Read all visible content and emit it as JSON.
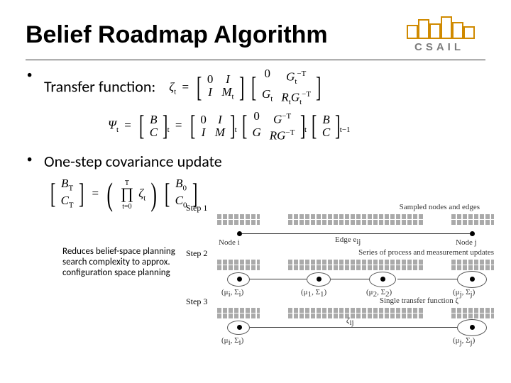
{
  "title": "Belief Roadmap Algorithm",
  "logo_word": "CSAIL",
  "bullets": {
    "b1": "Transfer function:",
    "b2": "One-step covariance update"
  },
  "eq1": {
    "lhs": "ζ",
    "lhs_sub": "t",
    "eqs": "=",
    "m1": {
      "r1c1": "0",
      "r1c2": "I",
      "r2c1": "I",
      "r2c2": "M",
      "r2c2_sub": "t"
    },
    "m2": {
      "r1c1": "0",
      "r1c2": "G",
      "r1c2_sub": "t",
      "r1c2_sup": "−T",
      "r2c1": "G",
      "r2c1_sub": "t",
      "r2c2a": "R",
      "r2c2a_sub": "t",
      "r2c2b": "G",
      "r2c2b_sub": "t",
      "r2c2b_sup": "−T"
    }
  },
  "eq2": {
    "lhs": "Ψ",
    "lhs_sub": "t",
    "eqs": "=",
    "col": {
      "top": "B",
      "bot": "C",
      "sub": "t"
    },
    "m1": {
      "r1c1": "0",
      "r1c2": "I",
      "r2c1": "I",
      "r2c2": "M",
      "sub": "t"
    },
    "m2": {
      "r1c1": "0",
      "r1c2": "G",
      "r1c2_sup": "−T",
      "r2c1": "G",
      "r2c2": "RG",
      "r2c2_sup": "−T",
      "sub": "t"
    },
    "m3": {
      "top": "B",
      "bot": "C",
      "sub": "t−1"
    }
  },
  "eq3": {
    "col_l": {
      "top": "B",
      "top_sub": "T",
      "bot": "C",
      "bot_sub": "T"
    },
    "eqs": "=",
    "prod_top": "T",
    "prod_bot": "t=0",
    "prod_body": "ζ",
    "prod_body_sub": "t",
    "col_r": {
      "top": "B",
      "top_sub": "0",
      "bot": "C",
      "bot_sub": "0"
    }
  },
  "note": {
    "l1": "Reduces belief-space planning",
    "l2": "search complexity to approx.",
    "l3": "configuration space planning"
  },
  "diagram": {
    "step1": {
      "label": "Step 1",
      "caption": "Sampled nodes and edges",
      "node_l": "Node i",
      "edge": "Edge e",
      "edge_sub": "ij",
      "node_r": "Node j"
    },
    "step2": {
      "label": "Step 2",
      "caption": "Series of process and measurement updates",
      "mu0": "(μ",
      "mu0s": "i",
      "sig0": ", Σ",
      "sig0s": "i",
      "close": ")",
      "mu1": "(μ",
      "mu1s": "1",
      "sig1": ", Σ",
      "sig1s": "1",
      "mu2": "(μ",
      "mu2s": "2",
      "sig2": ", Σ",
      "sig2s": "2",
      "muj": "(μ",
      "mujs": "j",
      "sigj": ", Σ",
      "sigjs": "j"
    },
    "step3": {
      "label": "Step 3",
      "caption": "Single transfer function ζ",
      "zeta": "ζ",
      "zeta_sub": "ij"
    }
  }
}
